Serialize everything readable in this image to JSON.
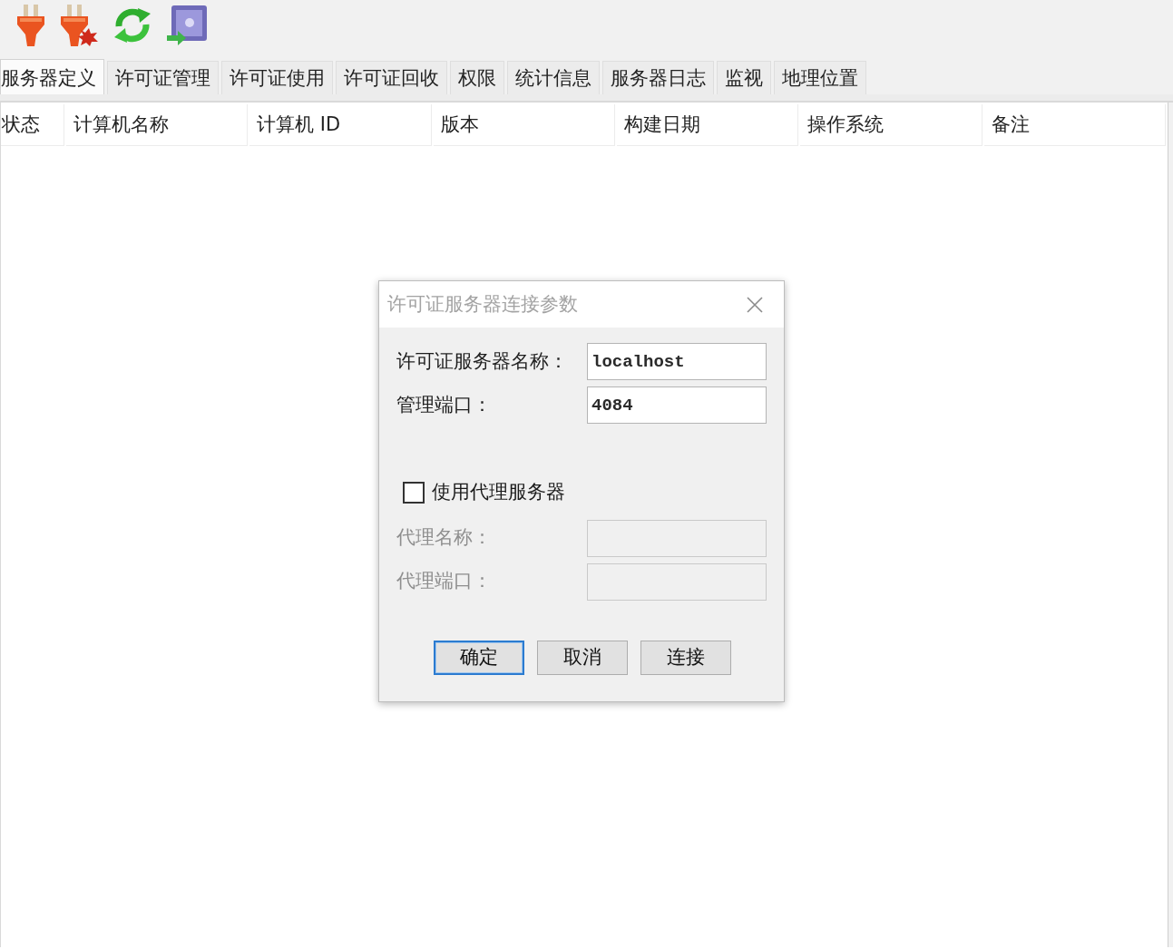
{
  "tabs": [
    {
      "label": "服务器定义",
      "selected": true
    },
    {
      "label": "许可证管理",
      "selected": false
    },
    {
      "label": "许可证使用",
      "selected": false
    },
    {
      "label": "许可证回收",
      "selected": false
    },
    {
      "label": "权限",
      "selected": false
    },
    {
      "label": "统计信息",
      "selected": false
    },
    {
      "label": "服务器日志",
      "selected": false
    },
    {
      "label": "监视",
      "selected": false
    },
    {
      "label": "地理位置",
      "selected": false
    }
  ],
  "table": {
    "columns": [
      "状态",
      "计算机名称",
      "计算机 ID",
      "版本",
      "构建日期",
      "操作系统",
      "备注"
    ]
  },
  "dialog": {
    "title": "许可证服务器连接参数",
    "fields": [
      {
        "label": "许可证服务器名称：",
        "value": "localhost",
        "disabled": false
      },
      {
        "label": "管理端口：",
        "value": "4084",
        "disabled": false
      }
    ],
    "proxy_checkbox": {
      "label": "使用代理服务器",
      "checked": false
    },
    "proxy_fields": [
      {
        "label": "代理名称：",
        "disabled": true
      },
      {
        "label": "代理端口：",
        "disabled": true
      }
    ],
    "buttons": [
      {
        "label": "确定",
        "default": true
      },
      {
        "label": "取消",
        "default": false
      },
      {
        "label": "连接",
        "default": false
      }
    ]
  }
}
